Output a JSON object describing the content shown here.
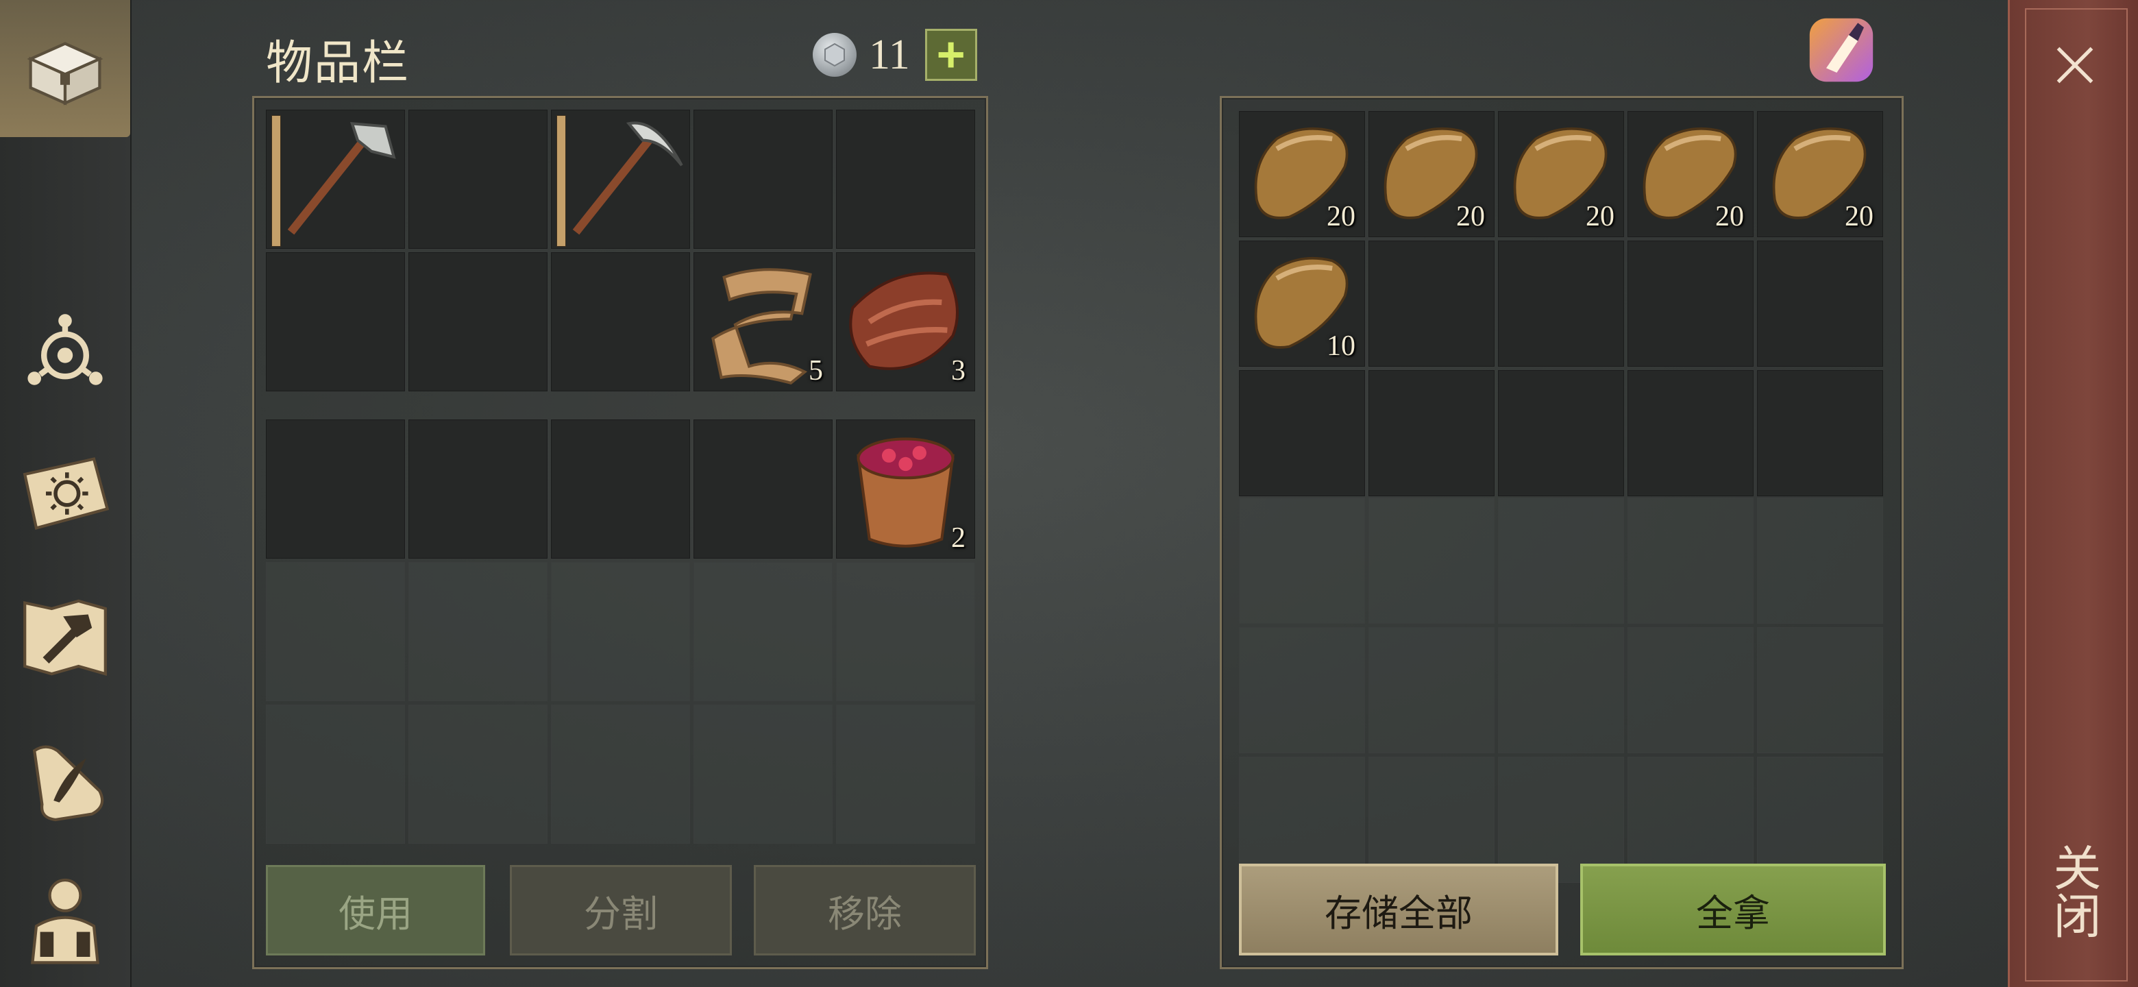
{
  "inventory": {
    "title": "物品栏",
    "currency_count": "11",
    "plus_label": "+",
    "main_slots": [
      {
        "item": "hatchet-icon",
        "qty": "",
        "durability": true
      },
      {
        "item": "",
        "qty": ""
      },
      {
        "item": "pickaxe-icon",
        "qty": "",
        "durability": true
      },
      {
        "item": "",
        "qty": ""
      },
      {
        "item": "",
        "qty": ""
      },
      {
        "item": "",
        "qty": ""
      },
      {
        "item": "",
        "qty": ""
      },
      {
        "item": "",
        "qty": ""
      },
      {
        "item": "cloth-scraps-icon",
        "qty": "5"
      },
      {
        "item": "leather-icon",
        "qty": "3"
      }
    ],
    "backpack_slots": [
      {
        "item": "",
        "qty": ""
      },
      {
        "item": "",
        "qty": ""
      },
      {
        "item": "",
        "qty": ""
      },
      {
        "item": "",
        "qty": ""
      },
      {
        "item": "berry-bowl-icon",
        "qty": "2"
      }
    ],
    "buttons": {
      "use": "使用",
      "split": "分割",
      "remove": "移除"
    }
  },
  "container": {
    "slots": [
      {
        "item": "ingot-icon",
        "qty": "20"
      },
      {
        "item": "ingot-icon",
        "qty": "20"
      },
      {
        "item": "ingot-icon",
        "qty": "20"
      },
      {
        "item": "ingot-icon",
        "qty": "20"
      },
      {
        "item": "ingot-icon",
        "qty": "20"
      },
      {
        "item": "ingot-icon",
        "qty": "10"
      }
    ],
    "buttons": {
      "store_all": "存储全部",
      "take_all": "全拿"
    }
  },
  "close": {
    "label": "关闭"
  },
  "sidebar": {
    "items": [
      "chest-icon",
      "blueprint-icon",
      "sun-book-icon",
      "map-hammer-icon",
      "scroll-quill-icon",
      "character-icon"
    ]
  }
}
